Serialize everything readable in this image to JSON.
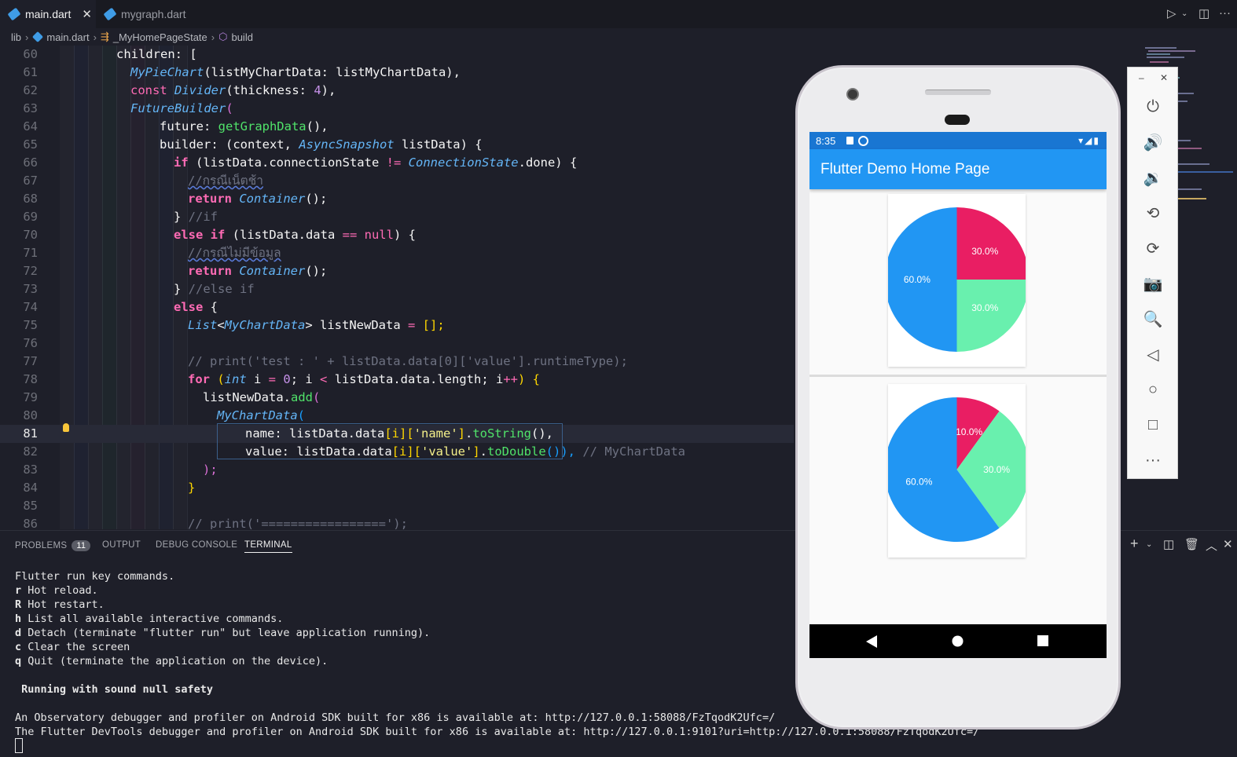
{
  "tabs": [
    {
      "label": "main.dart",
      "active": true
    },
    {
      "label": "mygraph.dart",
      "active": false
    }
  ],
  "breadcrumb": [
    "lib",
    "main.dart",
    "_MyHomePageState",
    "build"
  ],
  "editor": {
    "current_line": 81,
    "lines": [
      {
        "n": "60"
      },
      {
        "n": "61"
      },
      {
        "n": "62"
      },
      {
        "n": "63"
      },
      {
        "n": "64"
      },
      {
        "n": "65"
      },
      {
        "n": "66"
      },
      {
        "n": "67"
      },
      {
        "n": "68"
      },
      {
        "n": "69"
      },
      {
        "n": "70"
      },
      {
        "n": "71"
      },
      {
        "n": "72"
      },
      {
        "n": "73"
      },
      {
        "n": "74"
      },
      {
        "n": "75"
      },
      {
        "n": "76"
      },
      {
        "n": "77"
      },
      {
        "n": "78"
      },
      {
        "n": "79"
      },
      {
        "n": "80"
      },
      {
        "n": "81"
      },
      {
        "n": "82"
      },
      {
        "n": "83"
      },
      {
        "n": "84"
      },
      {
        "n": "85"
      },
      {
        "n": "86"
      }
    ],
    "text": {
      "l60": "children: [",
      "l61a": "MyPieChart",
      "l61b": "(listMyChartData: listMyChartData),",
      "l62a": "const",
      "l62b": "Divider",
      "l62c": "(thickness: ",
      "l62d": "4",
      "l62e": "),",
      "l63a": "FutureBuilder",
      "l63b": "(",
      "l64a": "future: ",
      "l64b": "getGraphData",
      "l64c": "(),",
      "l65a": "builder: (context, ",
      "l65b": "AsyncSnapshot",
      "l65c": " listData) {",
      "l66a": "if",
      "l66b": " (listData.connectionState ",
      "l66c": "!=",
      "l66d": "ConnectionState",
      "l66e": ".done) {",
      "l67": "//กรณีเน็ตช้า",
      "l68a": "return",
      "l68b": "Container",
      "l68c": "();",
      "l69a": "}",
      "l69b": " //if",
      "l70a": "else if",
      "l70b": " (listData.data ",
      "l70c": "==",
      "l70d": " null",
      "l70e": ") {",
      "l71": "//กรณีไม่มีข้อมูล",
      "l72a": "return",
      "l72b": "Container",
      "l72c": "();",
      "l73a": "}",
      "l73b": " //else if",
      "l74a": "else",
      "l74b": " {",
      "l75a": "List",
      "l75b": "<",
      "l75c": "MyChartData",
      "l75d": ">",
      " l75e": "",
      "l75f": " listNewData ",
      "l75g": "=",
      "l75h": " [];",
      "l77": "// print('test : ' + listData.data[0]['value'].runtimeType);",
      "l78a": "for",
      "l78b": " (",
      "l78c": "int",
      "l78d": " i ",
      "l78e": "=",
      "l78f": " 0",
      "l78g": "; i ",
      "l78h": "<",
      "l78i": " listData.data.length; i",
      "l78j": "++",
      "l78k": ") {",
      "l79a": "listNewData.",
      "l79b": "add",
      "l79c": "(",
      "l80a": "MyChartData",
      "l80b": "(",
      "l81a": "name",
      "l81b": ": listData.data",
      "l81c": "[i]",
      "l81d": "[",
      "l81e": "'name'",
      "l81f": "]",
      "l81g": ".",
      "l81h": "toString",
      "l81i": "(),",
      "l82a": "value",
      "l82b": ": listData.data",
      "l82c": "[i]",
      "l82d": "[",
      "l82e": "'value'",
      "l82f": "]",
      "l82g": ".",
      "l82h": "toDouble",
      "l82i": "()),",
      "l82j": " // MyChartData",
      "l83": ");",
      "l84": "}",
      "l86": "// print('=================');"
    }
  },
  "panel": {
    "tabs": [
      "PROBLEMS",
      "OUTPUT",
      "DEBUG CONSOLE",
      "TERMINAL"
    ],
    "problems_count": "11",
    "terminal": {
      "intro": "Flutter run key commands.",
      "cmds": [
        {
          "key": "r",
          "text": " Hot reload."
        },
        {
          "key": "R",
          "text": " Hot restart."
        },
        {
          "key": "h",
          "text": " List all available interactive commands."
        },
        {
          "key": "d",
          "text": " Detach (terminate \"flutter run\" but leave application running)."
        },
        {
          "key": "c",
          "text": " Clear the screen"
        },
        {
          "key": "q",
          "text": " Quit (terminate the application on the device)."
        }
      ],
      "safety": " Running with sound null safety",
      "observatory": "An Observatory debugger and profiler on Android SDK built for x86 is available at: http://127.0.0.1:58088/FzTqodK2Ufc=/",
      "devtools": "The Flutter DevTools debugger and profiler on Android SDK built for x86 is available at: http://127.0.0.1:9101?uri=http://127.0.0.1:58088/FzTqodK2Ufc=/"
    }
  },
  "phone": {
    "time": "8:35",
    "app_title": "Flutter Demo Home Page"
  },
  "chart_data": [
    {
      "type": "pie",
      "slices": [
        {
          "label": "30.0%",
          "value": 30,
          "color": "#e91e63"
        },
        {
          "label": "30.0%",
          "value": 30,
          "color": "#69f0ae"
        },
        {
          "label": "60.0%",
          "value": 60,
          "color": "#2196f3"
        }
      ],
      "title": ""
    },
    {
      "type": "pie",
      "slices": [
        {
          "label": "10.0%",
          "value": 10,
          "color": "#e91e63"
        },
        {
          "label": "30.0%",
          "value": 30,
          "color": "#69f0ae"
        },
        {
          "label": "60.0%",
          "value": 60,
          "color": "#2196f3"
        }
      ],
      "title": ""
    }
  ],
  "colors": {
    "accent": "#2196f3",
    "status_bar": "#1976d2"
  }
}
